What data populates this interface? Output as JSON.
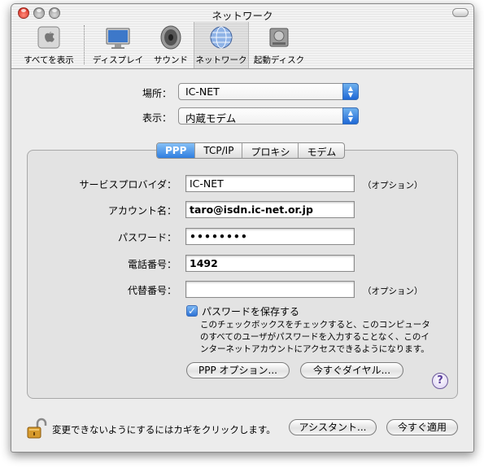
{
  "window": {
    "title": "ネットワーク"
  },
  "toolbar": {
    "items": [
      {
        "label": "すべてを表示",
        "icon": "apple-icon"
      },
      {
        "label": "ディスプレイ",
        "icon": "display-icon"
      },
      {
        "label": "サウンド",
        "icon": "speaker-icon"
      },
      {
        "label": "ネットワーク",
        "icon": "network-globe-icon",
        "selected": true
      },
      {
        "label": "起動ディスク",
        "icon": "disk-icon"
      }
    ]
  },
  "location": {
    "label": "場所：",
    "value": "IC-NET"
  },
  "show": {
    "label": "表示：",
    "value": "内蔵モデム"
  },
  "tabs": [
    "PPP",
    "TCP/IP",
    "プロキシ",
    "モデム"
  ],
  "form": {
    "service_provider": {
      "label": "サービスプロバイダ：",
      "value": "IC-NET",
      "note": "（オプション）"
    },
    "account_name": {
      "label": "アカウント名：",
      "value": "taro@isdn.ic-net.or.jp"
    },
    "password": {
      "label": "パスワード：",
      "value": "••••••••"
    },
    "phone_number": {
      "label": "電話番号：",
      "value": "1492"
    },
    "alternate_number": {
      "label": "代替番号：",
      "value": "",
      "note": "（オプション）"
    }
  },
  "save_password": {
    "label": "パスワードを保存する",
    "checked": true,
    "help": "このチェックボックスをチェックすると、このコンピュータのすべてのユーザがパスワードを入力することなく、このインターネットアカウントにアクセスできるようになります。"
  },
  "buttons": {
    "ppp_options": "PPP オプション...",
    "dial_now": "今すぐダイヤル...",
    "help": "?",
    "assistant": "アシスタント...",
    "apply_now": "今すぐ適用"
  },
  "lock": {
    "text": "変更できないようにするにはカギをクリックします。"
  },
  "colors": {
    "accent": "#2f7ee0",
    "close": "#d21c10"
  }
}
